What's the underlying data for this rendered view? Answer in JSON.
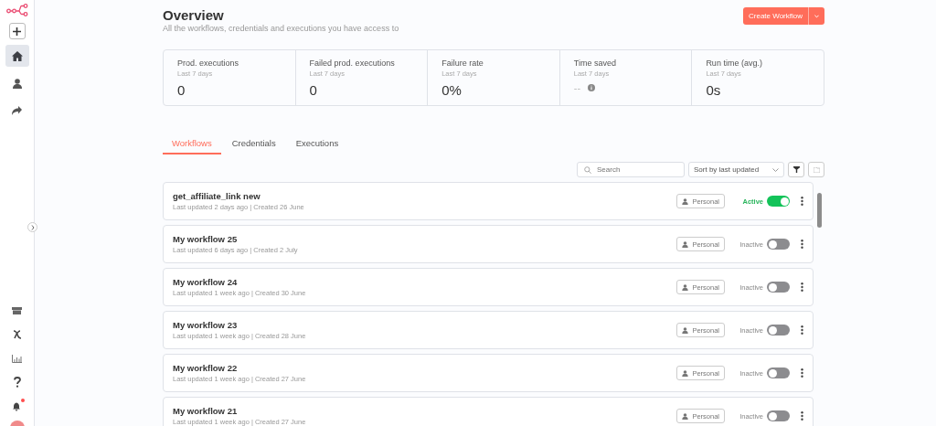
{
  "sidebar": {
    "nav": [
      {
        "kind": "home",
        "selected": true
      },
      {
        "kind": "user",
        "selected": false
      },
      {
        "kind": "share",
        "selected": false
      }
    ],
    "bottom": [
      {
        "kind": "box"
      },
      {
        "kind": "variables"
      },
      {
        "kind": "chart"
      },
      {
        "kind": "help"
      },
      {
        "kind": "bell",
        "has_notification": true
      }
    ]
  },
  "header": {
    "title": "Overview",
    "subtitle": "All the workflows, credentials and executions you have access to",
    "create_button": "Create Workflow"
  },
  "stats": [
    {
      "title": "Prod. executions",
      "period": "Last 7 days",
      "value": "0",
      "info": false
    },
    {
      "title": "Failed prod. executions",
      "period": "Last 7 days",
      "value": "0",
      "info": false
    },
    {
      "title": "Failure rate",
      "period": "Last 7 days",
      "value": "0%",
      "info": false
    },
    {
      "title": "Time saved",
      "period": "Last 7 days",
      "value": "--",
      "info": true
    },
    {
      "title": "Run time (avg.)",
      "period": "Last 7 days",
      "value": "0s",
      "info": false
    }
  ],
  "tabs": [
    {
      "label": "Workflows",
      "selected": true
    },
    {
      "label": "Credentials",
      "selected": false
    },
    {
      "label": "Executions",
      "selected": false
    }
  ],
  "toolbar": {
    "search_placeholder": "Search",
    "sort": "Sort by last updated"
  },
  "workflows": [
    {
      "name": "get_affiliate_link new",
      "dates": "Last updated 2 days ago | Created 26 June",
      "owner": "Personal",
      "status": "Active",
      "active": true
    },
    {
      "name": "My workflow 25",
      "dates": "Last updated 6 days ago | Created 2 July",
      "owner": "Personal",
      "status": "Inactive",
      "active": false
    },
    {
      "name": "My workflow 24",
      "dates": "Last updated 1 week ago | Created 30 June",
      "owner": "Personal",
      "status": "Inactive",
      "active": false
    },
    {
      "name": "My workflow 23",
      "dates": "Last updated 1 week ago | Created 28 June",
      "owner": "Personal",
      "status": "Inactive",
      "active": false
    },
    {
      "name": "My workflow 22",
      "dates": "Last updated 1 week ago | Created 27 June",
      "owner": "Personal",
      "status": "Inactive",
      "active": false
    },
    {
      "name": "My workflow 21",
      "dates": "Last updated 1 week ago | Created 27 June",
      "owner": "Personal",
      "status": "Inactive",
      "active": false
    }
  ]
}
